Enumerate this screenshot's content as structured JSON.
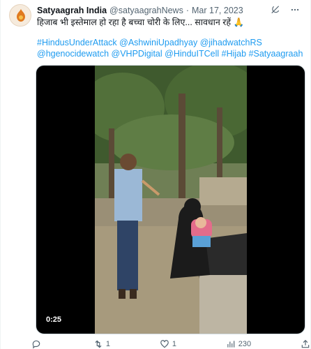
{
  "tweet": {
    "author_name": "Satyaagrah India",
    "handle": "@satyaagrahNews",
    "separator": "·",
    "date": "Mar 17, 2023",
    "text": "हिजाब भी इस्तेमाल हो रहा है बच्चा चोरी के लिए... सावधान रहें 🙏",
    "hashtags": [
      "#HindusUnderAttack",
      "@AshwiniUpadhyay",
      "@jihadwatchRS",
      "@hgenocidewatch",
      "@VHPDigital",
      "@HinduITCell",
      "#Hijab",
      "#Satyaagraah"
    ]
  },
  "media": {
    "duration": "0:25"
  },
  "actions": {
    "reply_count": "",
    "retweet_count": "1",
    "like_count": "1",
    "views_count": "230"
  },
  "colors": {
    "link": "#1d9bf0",
    "muted": "#536471",
    "text": "#0f1419"
  },
  "icons": {
    "header": [
      "grok-icon",
      "more-icon"
    ],
    "actions": [
      "reply-icon",
      "retweet-icon",
      "like-icon",
      "views-icon",
      "share-icon"
    ]
  }
}
